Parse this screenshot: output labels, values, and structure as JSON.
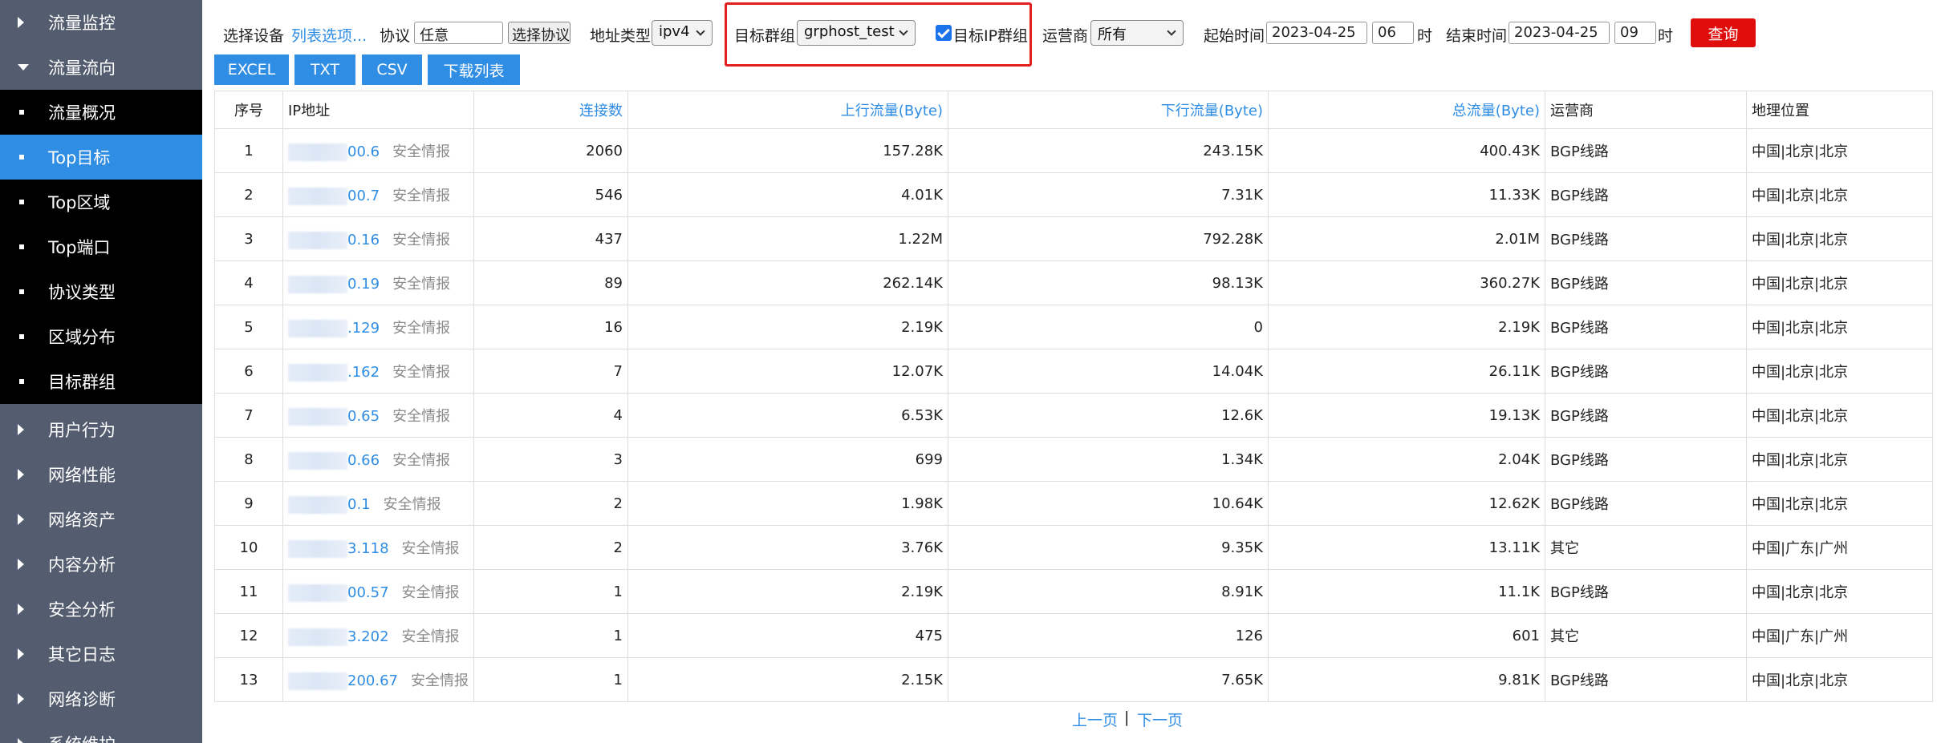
{
  "sidebar": {
    "top_items": [
      {
        "label": "流量监控"
      },
      {
        "label": "流量流向"
      }
    ],
    "sub_items": [
      {
        "label": "流量概况"
      },
      {
        "label": "Top目标"
      },
      {
        "label": "Top区域"
      },
      {
        "label": "Top端口"
      },
      {
        "label": "协议类型"
      },
      {
        "label": "区域分布"
      },
      {
        "label": "目标群组"
      }
    ],
    "bottom_items": [
      {
        "label": "用户行为"
      },
      {
        "label": "网络性能"
      },
      {
        "label": "网络资产"
      },
      {
        "label": "内容分析"
      },
      {
        "label": "安全分析"
      },
      {
        "label": "其它日志"
      },
      {
        "label": "网络诊断"
      },
      {
        "label": "系统维护"
      }
    ]
  },
  "filters": {
    "device_label": "选择设备",
    "device_link": "列表选项...",
    "protocol_label": "协议",
    "protocol_value": "任意",
    "protocol_button": "选择协议",
    "addr_type_label": "地址类型",
    "addr_type_value": "ipv4",
    "group_label": "目标群组",
    "group_value": "grphost_test",
    "ip_group_check_label": "目标IP群组",
    "isp_label": "运营商",
    "isp_value": "所有",
    "start_label": "起始时间",
    "start_date": "2023-04-25",
    "start_hour": "06",
    "hour_unit": "时",
    "end_label": "结束时间",
    "end_date": "2023-04-25",
    "end_hour": "09",
    "query_button": "查询"
  },
  "export_buttons": [
    "EXCEL",
    "TXT",
    "CSV",
    "下载列表"
  ],
  "table": {
    "headers": [
      "序号",
      "IP地址",
      "连接数",
      "上行流量(Byte)",
      "下行流量(Byte)",
      "总流量(Byte)",
      "运营商",
      "地理位置"
    ],
    "intel_label": "安全情报",
    "rows": [
      {
        "idx": "1",
        "ip": "00.6",
        "conn": "2060",
        "up": "157.28K",
        "down": "243.15K",
        "total": "400.43K",
        "isp": "BGP线路",
        "geo": "中国|北京|北京"
      },
      {
        "idx": "2",
        "ip": "00.7",
        "conn": "546",
        "up": "4.01K",
        "down": "7.31K",
        "total": "11.33K",
        "isp": "BGP线路",
        "geo": "中国|北京|北京"
      },
      {
        "idx": "3",
        "ip": "0.16",
        "conn": "437",
        "up": "1.22M",
        "down": "792.28K",
        "total": "2.01M",
        "isp": "BGP线路",
        "geo": "中国|北京|北京"
      },
      {
        "idx": "4",
        "ip": "0.19",
        "conn": "89",
        "up": "262.14K",
        "down": "98.13K",
        "total": "360.27K",
        "isp": "BGP线路",
        "geo": "中国|北京|北京"
      },
      {
        "idx": "5",
        "ip": ".129",
        "conn": "16",
        "up": "2.19K",
        "down": "0",
        "total": "2.19K",
        "isp": "BGP线路",
        "geo": "中国|北京|北京"
      },
      {
        "idx": "6",
        "ip": ".162",
        "conn": "7",
        "up": "12.07K",
        "down": "14.04K",
        "total": "26.11K",
        "isp": "BGP线路",
        "geo": "中国|北京|北京"
      },
      {
        "idx": "7",
        "ip": "0.65",
        "conn": "4",
        "up": "6.53K",
        "down": "12.6K",
        "total": "19.13K",
        "isp": "BGP线路",
        "geo": "中国|北京|北京"
      },
      {
        "idx": "8",
        "ip": "0.66",
        "conn": "3",
        "up": "699",
        "down": "1.34K",
        "total": "2.04K",
        "isp": "BGP线路",
        "geo": "中国|北京|北京"
      },
      {
        "idx": "9",
        "ip": "0.1",
        "conn": "2",
        "up": "1.98K",
        "down": "10.64K",
        "total": "12.62K",
        "isp": "BGP线路",
        "geo": "中国|北京|北京"
      },
      {
        "idx": "10",
        "ip": "3.118",
        "conn": "2",
        "up": "3.76K",
        "down": "9.35K",
        "total": "13.11K",
        "isp": "其它",
        "geo": "中国|广东|广州"
      },
      {
        "idx": "11",
        "ip": "00.57",
        "conn": "1",
        "up": "2.19K",
        "down": "8.91K",
        "total": "11.1K",
        "isp": "BGP线路",
        "geo": "中国|北京|北京"
      },
      {
        "idx": "12",
        "ip": "3.202",
        "conn": "1",
        "up": "475",
        "down": "126",
        "total": "601",
        "isp": "其它",
        "geo": "中国|广东|广州"
      },
      {
        "idx": "13",
        "ip": "200.67",
        "conn": "1",
        "up": "2.15K",
        "down": "7.65K",
        "total": "9.81K",
        "isp": "BGP线路",
        "geo": "中国|北京|北京"
      }
    ]
  },
  "pager": {
    "prev": "上一页",
    "sep": "|",
    "next": "下一页"
  }
}
